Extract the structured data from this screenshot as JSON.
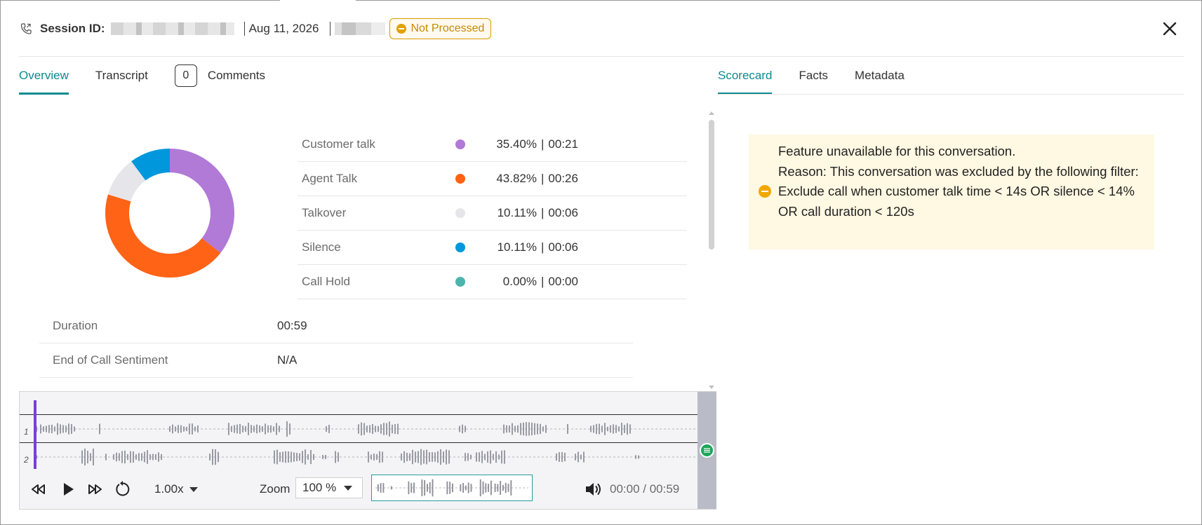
{
  "header": {
    "session_label": "Session ID:",
    "date": "Aug 11, 2026",
    "status": "Not Processed"
  },
  "tabs_left": [
    {
      "label": "Overview",
      "active": true
    },
    {
      "label": "Transcript",
      "active": false
    },
    {
      "label": "Comments",
      "count": "0",
      "active": false
    }
  ],
  "tabs_right": [
    {
      "label": "Scorecard",
      "active": true
    },
    {
      "label": "Facts",
      "active": false
    },
    {
      "label": "Metadata",
      "active": false
    }
  ],
  "talk_stats": [
    {
      "label": "Customer talk",
      "percent": "35.40%",
      "time": "00:21",
      "color": "#b07ad6"
    },
    {
      "label": "Agent Talk",
      "percent": "43.82%",
      "time": "00:26",
      "color": "#ff6316"
    },
    {
      "label": "Talkover",
      "percent": "10.11%",
      "time": "00:06",
      "color": "#e6e6ea"
    },
    {
      "label": "Silence",
      "percent": "10.11%",
      "time": "00:06",
      "color": "#0097dc"
    },
    {
      "label": "Call Hold",
      "percent": "0.00%",
      "time": "00:00",
      "color": "#4db3ad"
    }
  ],
  "info": [
    {
      "label": "Duration",
      "value": "00:59"
    },
    {
      "label": "End of Call Sentiment",
      "value": "N/A"
    }
  ],
  "player": {
    "channels": [
      "1",
      "2"
    ],
    "speed": "1.00x",
    "zoom_label": "Zoom",
    "zoom_value": "100 %",
    "time": "00:00 / 00:59"
  },
  "notice": {
    "lines": [
      "Feature unavailable for this conversation.",
      "Reason: This conversation was excluded by the following filter:",
      "Exclude call when customer talk time < 14s OR silence < 14% OR call duration < 120s"
    ]
  }
}
